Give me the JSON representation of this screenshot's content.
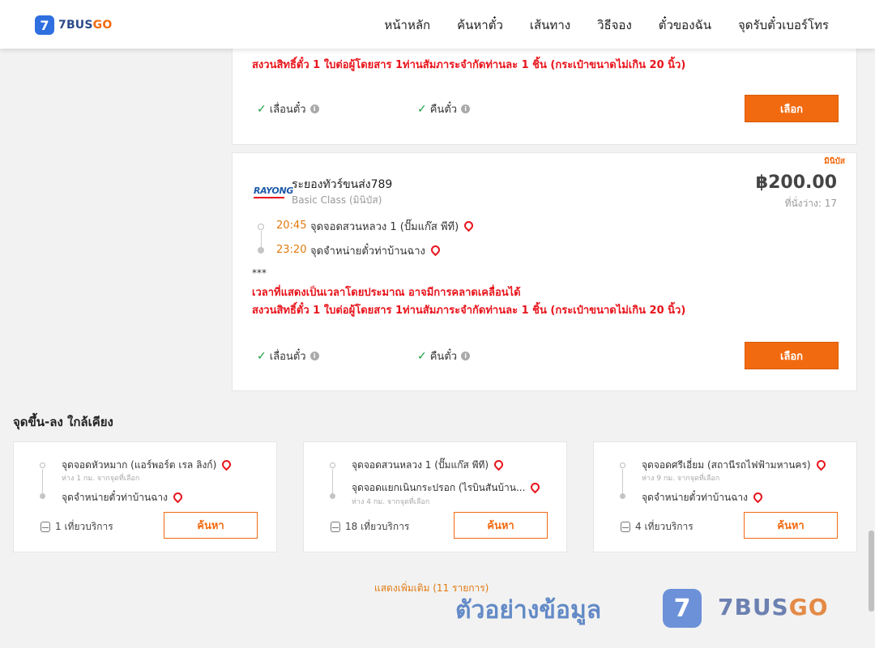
{
  "header": {
    "logo_mark": "7",
    "logo_text": "7BUS",
    "logo_text_go": "GO",
    "nav": [
      "หน้าหลัก",
      "ค้นหาตั๋ว",
      "เส้นทาง",
      "วิธีจอง",
      "ตั๋วของฉัน",
      "จุดรับตั๋วเบอร์โทร"
    ]
  },
  "top_card": {
    "warning": "สงวนสิทธิ์ตั๋ว 1 ใบต่อผู้โดยสาร 1ท่านสัมภาระจำกัดท่านละ 1 ชิ้น (กระเป๋าขนาดไม่เกิน 20 นิ้ว)",
    "feature_1": "เลื่อนตั๋ว",
    "feature_2": "คืนตั๋ว",
    "select": "เลือก"
  },
  "main_card": {
    "tag": "มินิบัส",
    "logo": "RAYONG",
    "operator": "ระยองทัวร์ขนส่ง789",
    "class": "Basic Class (มินิบัส)",
    "price": "฿200.00",
    "seats": "ที่นั่งว่าง: 17",
    "dep_time": "20:45",
    "dep_stop": "จุดจอดสวนหลวง 1 (ปั๊มแก๊ส พีที)",
    "arr_time": "23:20",
    "arr_stop": "จุดจำหน่ายตั๋วท่าบ้านฉาง",
    "stars": "***",
    "note_1": "เวลาที่แสดงเป็นเวลาโดยประมาณ อาจมีการคลาดเคลื่อนได้",
    "note_2": "สงวนสิทธิ์ตั๋ว 1 ใบต่อผู้โดยสาร 1ท่านสัมภาระจำกัดท่านละ 1 ชิ้น (กระเป๋าขนาดไม่เกิน 20 นิ้ว)",
    "feature_1": "เลื่อนตั๋ว",
    "feature_2": "คืนตั๋ว",
    "select": "เลือก"
  },
  "nearby": {
    "title": "จุดขึ้น-ลง ใกล้เคียง",
    "cards": [
      {
        "from": "จุดจอดหัวหมาก (แอร์พอร์ต เรล ลิงก์)",
        "from_sub": "ห่าง 1 กม. จากจุดที่เลือก",
        "to": "จุดจำหน่ายตั๋วท่าบ้านฉาง",
        "to_sub": "",
        "trips": "1 เที่ยวบริการ",
        "button": "ค้นหา"
      },
      {
        "from": "จุดจอดสวนหลวง 1 (ปั๊มแก๊ส พีที)",
        "from_sub": "",
        "to": "จุดจอดแยกเนินกระปรอก (ไรบินสันบ้าน...",
        "to_sub": "ห่าง 4 กม. จากจุดที่เลือก",
        "trips": "18 เที่ยวบริการ",
        "button": "ค้นหา"
      },
      {
        "from": "จุดจอดศรีเอี่ยม (สถานีรถไฟฟ้ามหานคร)",
        "from_sub": "ห่าง 9 กม. จากจุดที่เลือก",
        "to": "จุดจำหน่ายตั๋วท่าบ้านฉาง",
        "to_sub": "",
        "trips": "4 เที่ยวบริการ",
        "button": "ค้นหา"
      }
    ],
    "show_more": "แสดงเพิ่มเติม (11 รายการ)"
  },
  "watermark": {
    "text": "ตัวอย่างข้อมูล",
    "mark": "7",
    "brand": "7BUS",
    "brand_go": "GO"
  },
  "colors": {
    "accent": "#f26a10",
    "warning": "#e8141c",
    "check": "#1a9c3c"
  }
}
